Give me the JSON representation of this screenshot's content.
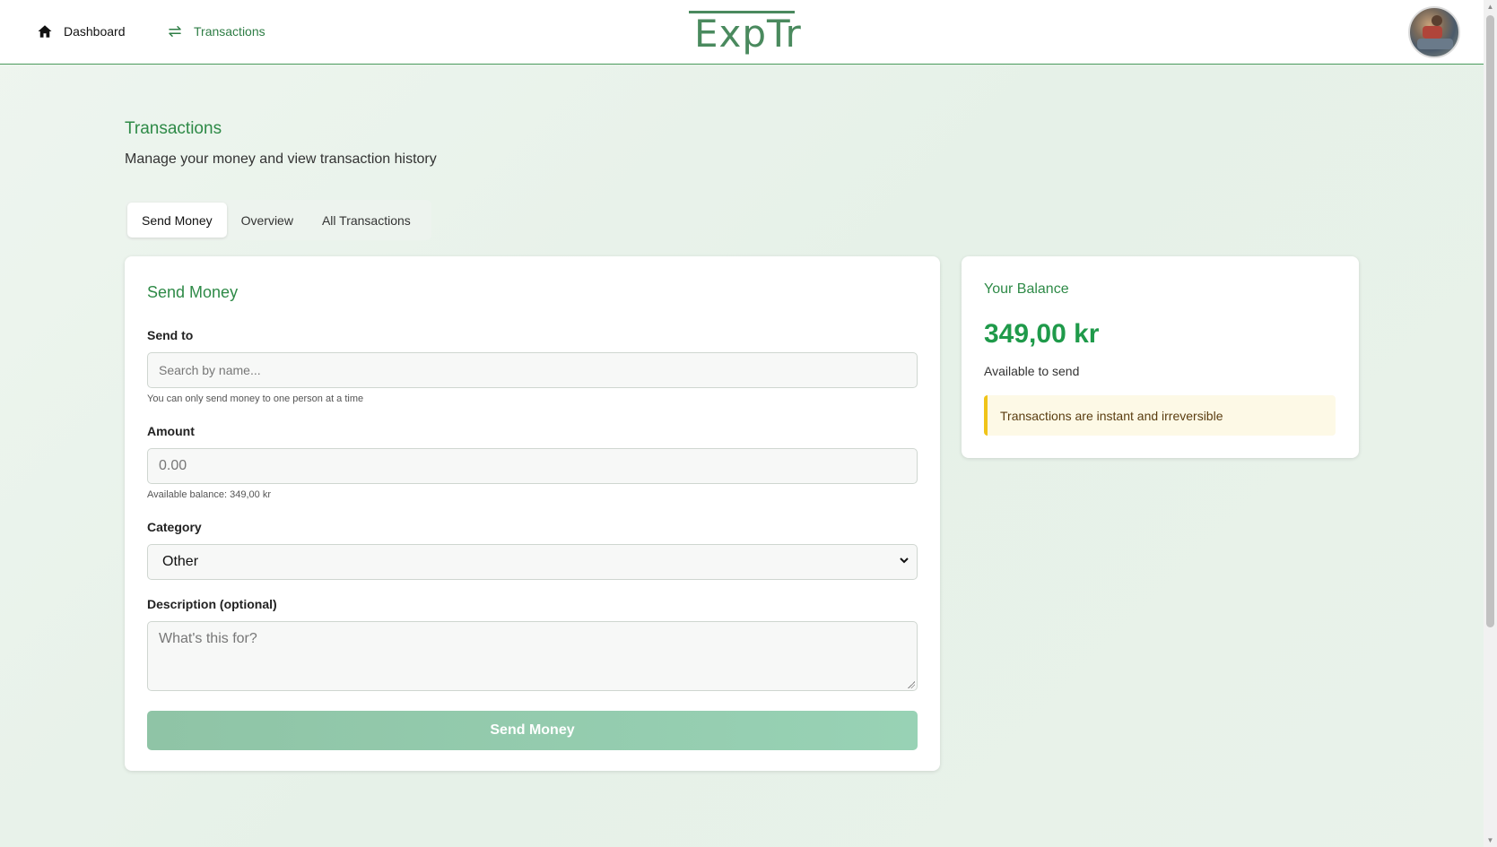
{
  "nav": {
    "dashboard_label": "Dashboard",
    "transactions_label": "Transactions",
    "logo_text": "ExpTr",
    "dashboard_icon": "home-icon",
    "transactions_icon": "swap-arrows-icon"
  },
  "header": {
    "title": "Transactions",
    "subtitle": "Manage your money and view transaction history"
  },
  "tabs": [
    {
      "label": "Send Money",
      "active": true
    },
    {
      "label": "Overview",
      "active": false
    },
    {
      "label": "All Transactions",
      "active": false
    }
  ],
  "send_form": {
    "title": "Send Money",
    "send_to_label": "Send to",
    "send_to_placeholder": "Search by name...",
    "send_to_hint": "You can only send money to one person at a time",
    "amount_label": "Amount",
    "amount_placeholder": "0.00",
    "amount_hint": "Available balance: 349,00 kr",
    "category_label": "Category",
    "category_value": "Other",
    "description_label": "Description (optional)",
    "description_placeholder": "What's this for?",
    "submit_label": "Send Money"
  },
  "balance": {
    "title": "Your Balance",
    "amount": "349,00 kr",
    "subtitle": "Available to send",
    "notice": "Transactions are instant and irreversible"
  },
  "colors": {
    "accent": "#2e8a47",
    "balance": "#1f9a4a",
    "button": "#94ccae",
    "notice_border": "#f0c419"
  }
}
